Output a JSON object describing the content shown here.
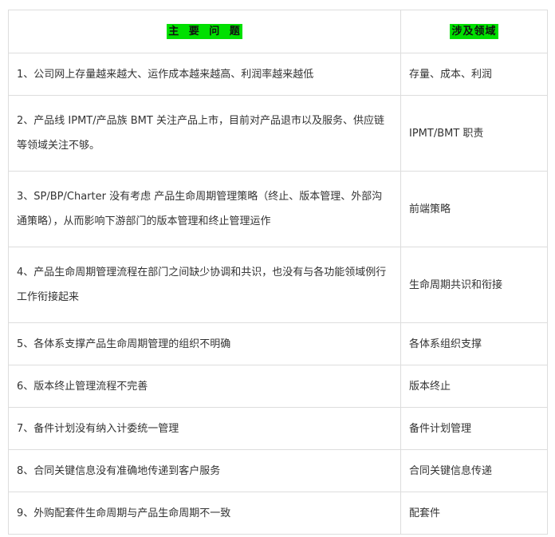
{
  "header": {
    "issue_col": "主 要  问 题",
    "domain_col": "涉及领域"
  },
  "rows": [
    {
      "issue": "1、公司网上存量越来越大、运作成本越来越高、利润率越来越低",
      "domain": "存量、成本、利润"
    },
    {
      "issue": "2、产品线 IPMT/产品族 BMT 关注产品上市，目前对产品退市以及服务、供应链等领域关注不够。",
      "domain": "IPMT/BMT 职责"
    },
    {
      "issue": "3、SP/BP/Charter 没有考虑    产品生命周期管理策略（终止、版本管理、外部沟通策略），从而影响下游部门的版本管理和终止管理运作",
      "domain": "前端策略"
    },
    {
      "issue": "4、产品生命周期管理流程在部门之间缺少协调和共识，也没有与各功能领域例行工作衔接起来",
      "domain": "生命周期共识和衔接"
    },
    {
      "issue": "5、各体系支撑产品生命周期管理的组织不明确",
      "domain": "各体系组织支撑"
    },
    {
      "issue": "6、版本终止管理流程不完善",
      "domain": "版本终止"
    },
    {
      "issue": "7、备件计划没有纳入计委统一管理",
      "domain": "备件计划管理"
    },
    {
      "issue": "8、合同关键信息没有准确地传递到客户服务",
      "domain": "合同关键信息传递"
    },
    {
      "issue": "9、外购配套件生命周期与产品生命周期不一致",
      "domain": "配套件"
    }
  ],
  "colors": {
    "header_highlight": "#00e000",
    "border": "#dddddd",
    "text": "#333333"
  }
}
